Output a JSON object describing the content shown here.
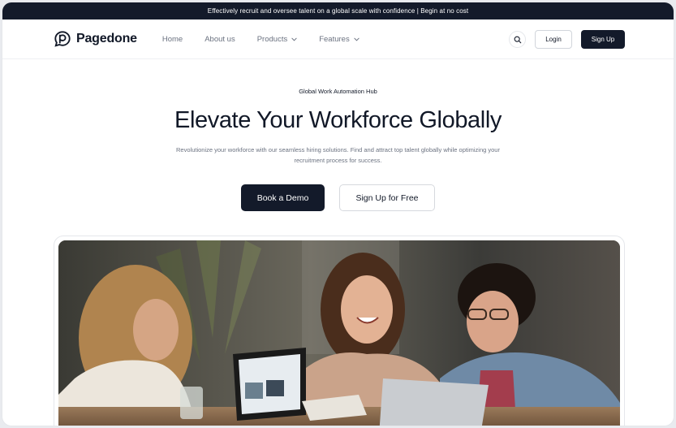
{
  "announcement": "Effectively recruit and oversee talent on a global scale with confidence | Begin at no cost",
  "brand": {
    "name": "Pagedone"
  },
  "nav": {
    "items": [
      {
        "label": "Home",
        "has_dropdown": false
      },
      {
        "label": "About us",
        "has_dropdown": false
      },
      {
        "label": "Products",
        "has_dropdown": true
      },
      {
        "label": "Features",
        "has_dropdown": true
      }
    ],
    "login_label": "Login",
    "signup_label": "Sign Up"
  },
  "hero": {
    "eyebrow": "Global Work Automation Hub",
    "title": "Elevate Your Workforce Globally",
    "subtitle": "Revolutionize your workforce with our seamless hiring solutions. Find and attract top talent globally while optimizing your recruitment process for success.",
    "primary_cta": "Book a Demo",
    "secondary_cta": "Sign Up for Free"
  },
  "icons": {
    "logo": "chat-bubble-logo-icon",
    "search": "search-icon",
    "dropdown": "chevron-down-icon"
  },
  "colors": {
    "primary_dark": "#131a2a",
    "text": "#111827",
    "muted": "#6b7280",
    "border": "#e5e7eb"
  }
}
